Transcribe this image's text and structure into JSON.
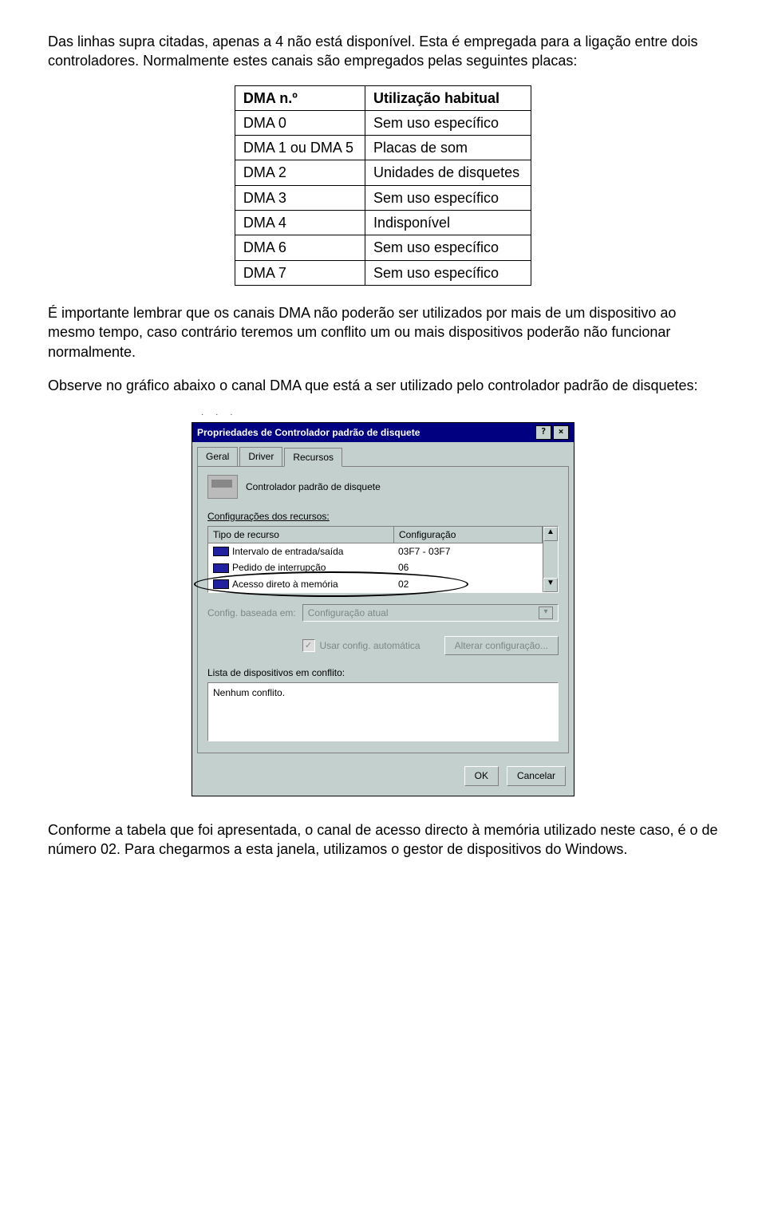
{
  "p1": "Das linhas supra citadas, apenas a 4 não está disponível. Esta é empregada para a ligação entre dois controladores. Normalmente estes canais são empregados pelas seguintes placas:",
  "table": {
    "head": {
      "c1": "DMA n.º",
      "c2": "Utilização habitual"
    },
    "rows": [
      {
        "c1": "DMA 0",
        "c2": "Sem uso específico"
      },
      {
        "c1": "DMA 1 ou DMA 5",
        "c2": "Placas de som"
      },
      {
        "c1": "DMA 2",
        "c2": "Unidades de disquetes"
      },
      {
        "c1": "DMA 3",
        "c2": "Sem uso específico"
      },
      {
        "c1": "DMA 4",
        "c2": "Indisponível"
      },
      {
        "c1": "DMA 6",
        "c2": "Sem uso específico"
      },
      {
        "c1": "DMA 7",
        "c2": "Sem uso específico"
      }
    ]
  },
  "p2": "É importante lembrar que os canais DMA não poderão ser utilizados por mais de um dispositivo ao mesmo tempo, caso contrário teremos um conflito um ou mais dispositivos poderão não funcionar normalmente.",
  "p3": "Observe no gráfico abaixo o canal DMA que está a ser utilizado pelo controlador padrão de disquetes:",
  "dialog": {
    "title": "Propriedades de Controlador padrão de disquete",
    "help_btn": "?",
    "close_btn": "×",
    "tabs": {
      "geral": "Geral",
      "driver": "Driver",
      "recursos": "Recursos"
    },
    "device_name": "Controlador padrão de disquete",
    "config_label": "Configurações dos recursos:",
    "list": {
      "head": {
        "c1": "Tipo de recurso",
        "c2": "Configuração"
      },
      "rows": [
        {
          "c1": "Intervalo de entrada/saída",
          "c2": "03F7 - 03F7"
        },
        {
          "c1": "Pedido de interrupção",
          "c2": "06"
        },
        {
          "c1": "Acesso direto à memória",
          "c2": "02"
        }
      ]
    },
    "config_based_label": "Config. baseada em:",
    "config_based_value": "Configuração atual",
    "auto_checkbox": "Usar config. automática",
    "change_btn": "Alterar configuração...",
    "conflict_label": "Lista de dispositivos em conflito:",
    "conflict_value": "Nenhum conflito.",
    "ok_btn": "OK",
    "cancel_btn": "Cancelar"
  },
  "p4": "Conforme a tabela que foi apresentada, o canal de acesso directo à memória utilizado neste caso, é o de número 02. Para chegarmos a esta janela, utilizamos o gestor de dispositivos do Windows."
}
